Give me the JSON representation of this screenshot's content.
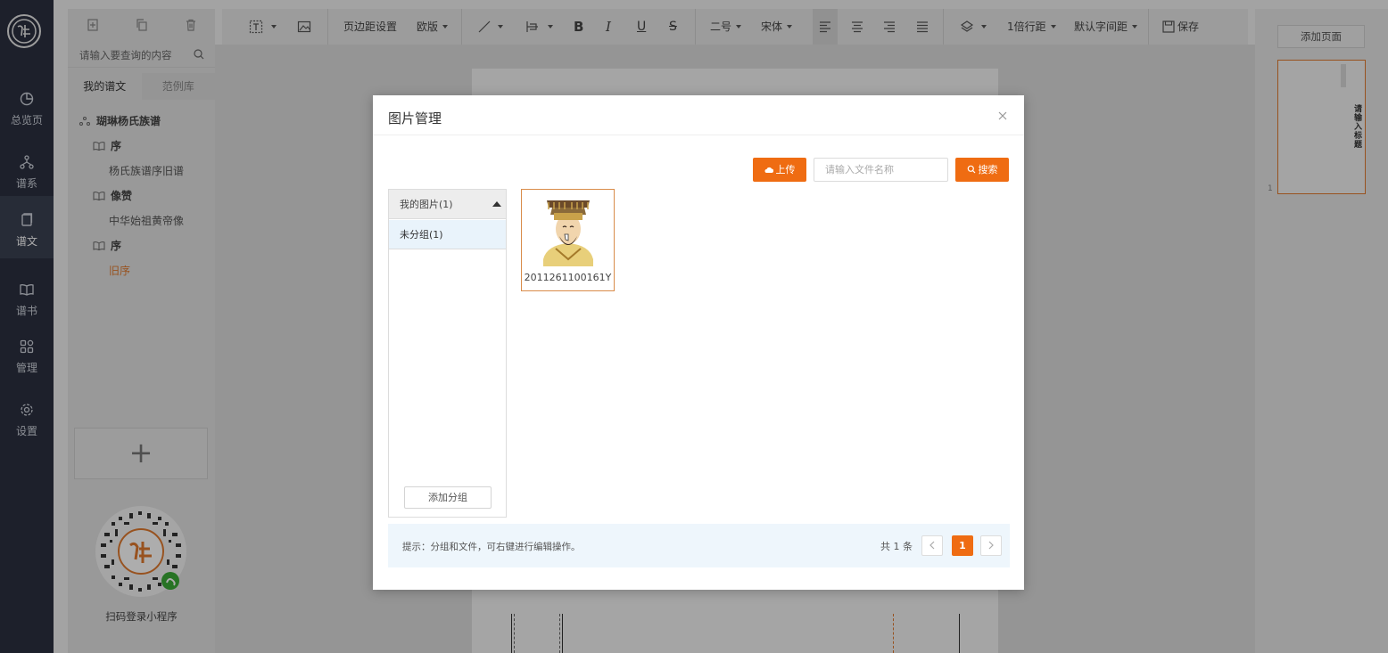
{
  "rail": {
    "items": [
      {
        "label": "总览页"
      },
      {
        "label": "谱系"
      },
      {
        "label": "谱文"
      },
      {
        "label": "谱书"
      },
      {
        "label": "管理"
      },
      {
        "label": "设置"
      }
    ]
  },
  "sidebar": {
    "search_placeholder": "请输入要查询的内容",
    "tabs": [
      {
        "label": "我的谱文"
      },
      {
        "label": "范例库"
      }
    ],
    "tree": {
      "root": "瑚琳杨氏族谱",
      "nodes": [
        {
          "label": "序"
        },
        {
          "label": "杨氏族谱序旧谱"
        },
        {
          "label": "像赞"
        },
        {
          "label": "中华始祖黄帝像"
        },
        {
          "label": "序"
        },
        {
          "label": "旧序"
        }
      ]
    },
    "qr_caption": "扫码登录小程序"
  },
  "toolbar": {
    "margin_settings": "页边距设置",
    "layout": "欧版",
    "font_size": "二号",
    "font_family": "宋体",
    "line_height": "1倍行距",
    "letter_spacing": "默认字间距",
    "save": "保存"
  },
  "right_panel": {
    "add_page": "添加页面",
    "thumb_title": "请输入标题",
    "page_number": "1"
  },
  "modal": {
    "title": "图片管理",
    "upload": "上传",
    "search_placeholder": "请输入文件名称",
    "search": "搜索",
    "group_header": "我的图片(1)",
    "group_item": "未分组(1)",
    "add_group": "添加分组",
    "images": [
      {
        "name": "2011261100161Y"
      }
    ],
    "tip": "提示：分组和文件，可右键进行编辑操作。",
    "total": "共 1 条",
    "current_page": "1"
  },
  "colors": {
    "accent": "#ef6c12",
    "rail_bg": "#2b3040"
  }
}
